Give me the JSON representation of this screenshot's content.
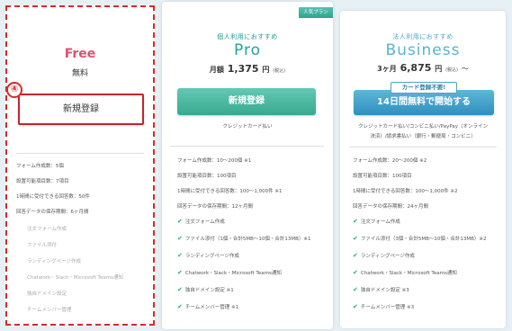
{
  "free": {
    "name": "Free",
    "price": "無料",
    "button": "新規登録",
    "annotation": "④",
    "specs": [
      "フォーム作成数：5個",
      "設置可能項目数：7項目",
      "1時間に受付できる回答数：50件",
      "回答データの保存期間：6ヶ月間"
    ],
    "features": [
      "注文フォーム作成",
      "ファイル添付",
      "ランディングページ作成",
      "Chatwork・Slack・Microsoft Teams通知",
      "独自ドメイン設定",
      "チームメンバー管理"
    ]
  },
  "pro": {
    "ribbon": "人気プラン",
    "sub": "個人利用におすすめ",
    "name": "Pro",
    "price_prefix": "月額",
    "price_value": "1,375",
    "price_unit": "円",
    "price_tax": "(税込)",
    "button": "新規登録",
    "note": "クレジットカード払い",
    "specs": [
      "フォーム作成数：10〜200個 ※1",
      "設置可能項目数：100項目",
      "1時間に受付できる回答数：100〜1,000件 ※1",
      "回答データの保存期間：12ヶ月間"
    ],
    "features": [
      "注文フォーム作成",
      "ファイル添付（1個・合計5MB〜10個・合計13MB）※1",
      "ランディングページ作成",
      "Chatwork・Slack・Microsoft Teams通知",
      "独自ドメイン設定 ※1",
      "チームメンバー管理 ※1"
    ]
  },
  "biz": {
    "sub": "法人利用におすすめ",
    "name": "Business",
    "price_prefix": "3ヶ月",
    "price_value": "6,875",
    "price_unit": "円",
    "price_tax": "(税込)",
    "price_suffix": "〜",
    "badge": "カード登録不要!",
    "button": "14日間無料で開始する",
    "note_line1": "クレジットカード払い/コンビニ払い/PayPay（オンライン",
    "note_line2": "決済）/請求書払い（銀行・郵便局・コンビニ）",
    "specs": [
      "フォーム作成数：20〜200個 ※2",
      "設置可能項目数：100項目",
      "1時間に受付できる回答数：100〜1,000件 ※2",
      "回答データの保存期間：24ヶ月間"
    ],
    "features": [
      "注文フォーム作成",
      "ファイル添付（3個・合計5MB〜10個・合計13MB）※2",
      "ランディングページ作成",
      "Chatwork・Slack・Microsoft Teams通知",
      "独自ドメイン設定 ※3",
      "チームメンバー管理 ※3"
    ]
  },
  "colors": {
    "free_border": "#d62b2b",
    "pro_accent": "#2ea38e",
    "biz_accent": "#3f9fc8"
  },
  "icons": {
    "check": "check-icon"
  }
}
